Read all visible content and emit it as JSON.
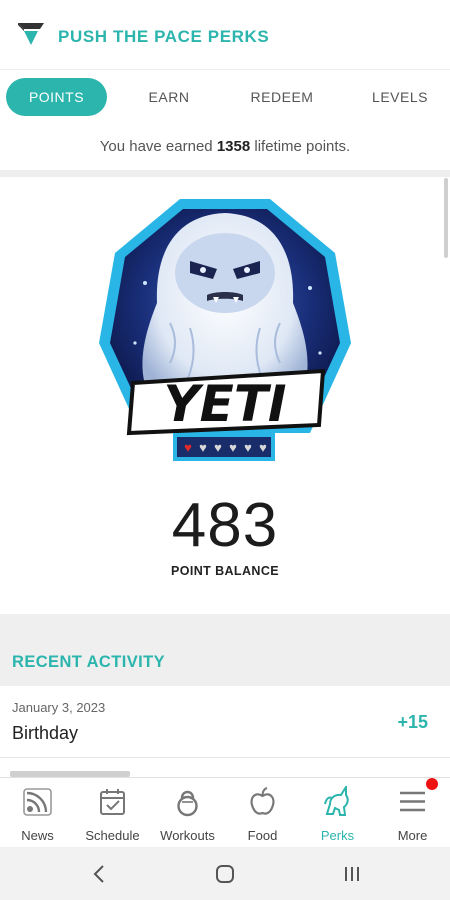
{
  "header": {
    "title": "PUSH THE PACE PERKS",
    "logo_icon": "ptp-logo-icon"
  },
  "tabs": [
    {
      "label": "POINTS",
      "active": true
    },
    {
      "label": "EARN",
      "active": false
    },
    {
      "label": "REDEEM",
      "active": false
    },
    {
      "label": "LEVELS",
      "active": false
    }
  ],
  "lifetime": {
    "prefix": "You have earned ",
    "points": "1358",
    "suffix": " lifetime points."
  },
  "level_badge": {
    "name": "YETI",
    "icon": "yeti-level-badge",
    "hearts_filled": 1,
    "hearts_total": 6
  },
  "balance": {
    "value": "483",
    "label": "POINT BALANCE"
  },
  "recent_activity": {
    "title": "RECENT ACTIVITY",
    "items": [
      {
        "date": "January 3, 2023",
        "name": "Birthday",
        "points": "+15"
      }
    ]
  },
  "bottom_nav": [
    {
      "label": "News",
      "icon": "news-feed-icon",
      "active": false
    },
    {
      "label": "Schedule",
      "icon": "schedule-calendar-icon",
      "active": false
    },
    {
      "label": "Workouts",
      "icon": "kettlebell-icon",
      "active": false
    },
    {
      "label": "Food",
      "icon": "apple-icon",
      "active": false
    },
    {
      "label": "Perks",
      "icon": "unicorn-icon",
      "active": true
    },
    {
      "label": "More",
      "icon": "menu-icon",
      "active": false,
      "badge": true
    }
  ],
  "system_nav": [
    "back-icon",
    "home-icon",
    "recents-icon"
  ],
  "colors": {
    "accent": "#2bb5ad",
    "badge_blue": "#29b6e6",
    "notification": "#ee1111"
  }
}
